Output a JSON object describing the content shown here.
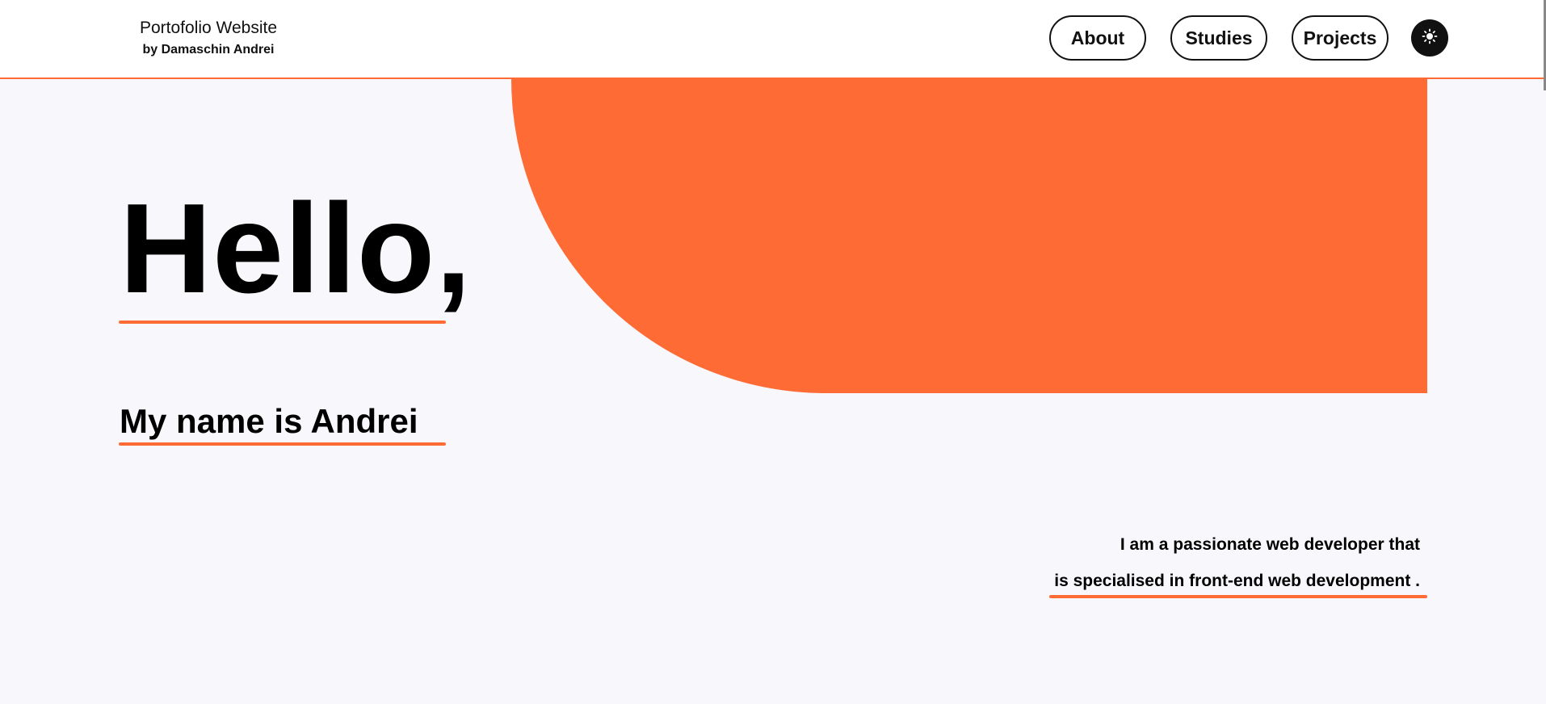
{
  "header": {
    "brand_title": "Portofolio Website",
    "brand_subtitle": "by Damaschin Andrei",
    "nav": {
      "about": "About",
      "studies": "Studies",
      "projects": "Projects"
    },
    "theme_toggle_icon": "sun-icon"
  },
  "hero": {
    "greeting": "Hello,",
    "name_line": "My name is Andrei",
    "intro_line_1": "I am a passionate web developer that",
    "intro_line_2": "is specialised in front-end web development ."
  },
  "colors": {
    "accent": "#ff6b35",
    "background": "#f8f8fc",
    "header_bg": "#ffffff",
    "text": "#000000"
  }
}
